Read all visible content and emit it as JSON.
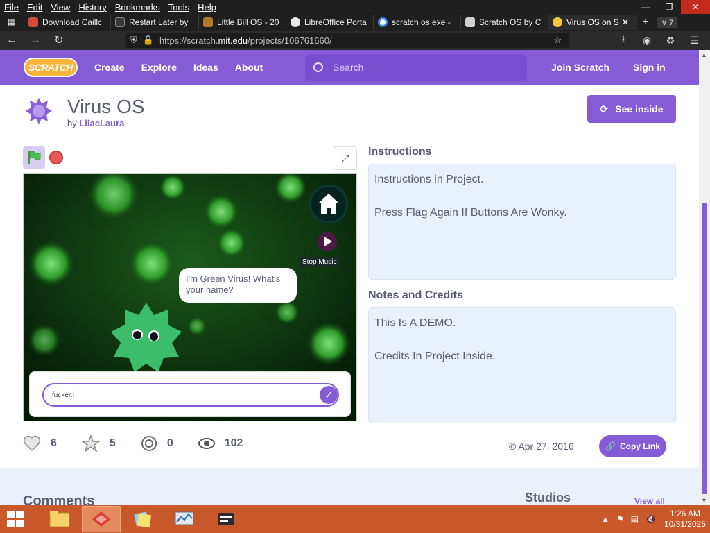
{
  "browser": {
    "menu": [
      "File",
      "Edit",
      "View",
      "History",
      "Bookmarks",
      "Tools",
      "Help"
    ],
    "window_controls": [
      "minimize-icon",
      "restore-icon",
      "close-icon"
    ],
    "tabs": [
      {
        "label": "Download Caillc",
        "favicon_color": "#d14a3c"
      },
      {
        "label": "Restart Later by",
        "favicon_color": "#3a3a3a"
      },
      {
        "label": "Little Bill OS - 20",
        "favicon_color": "#b07a2c"
      },
      {
        "label": "LibreOffice Porta",
        "favicon_color": "#e9e9e9"
      },
      {
        "label": "scratch os exe -",
        "favicon_color": "#ffffff"
      },
      {
        "label": "Scratch OS by C",
        "favicon_color": "#cfcfcf"
      },
      {
        "label": "Virus OS on S",
        "favicon_color": "#f4c542"
      }
    ],
    "tab_count": "7",
    "new_tab": "+",
    "url_prefix": "https://scratch.",
    "url_domain": "mit.edu",
    "url_path": "/projects/106761660/"
  },
  "scratch_nav": {
    "logo": "SCRATCH",
    "links": [
      "Create",
      "Explore",
      "Ideas",
      "About"
    ],
    "search_placeholder": "Search",
    "join": "Join Scratch",
    "signin": "Sign in"
  },
  "project": {
    "title": "Virus OS",
    "by_prefix": "by ",
    "author": "LilacLaura",
    "see_inside": "See inside",
    "stage": {
      "speech": "I'm Green Virus! What's your name?",
      "stop_music": "Stop Music",
      "answer": "fucker.|"
    },
    "instructions_title": "Instructions",
    "instructions": [
      "Instructions in Project.",
      "Press Flag Again If Buttons Are Wonky."
    ],
    "notes_title": "Notes and Credits",
    "notes": [
      "This Is A DEMO.",
      "Credits In Project Inside."
    ],
    "stats": {
      "loves": "6",
      "favorites": "5",
      "remixes": "0",
      "views": "102"
    },
    "date": "Apr 27, 2016",
    "copy_link": "Copy Link",
    "comments_title": "Comments",
    "studios_title": "Studios",
    "view_all": "View all"
  },
  "taskbar": {
    "time": "1:26 AM",
    "date": "10/31/2025"
  },
  "colors": {
    "accent": "#855cd6",
    "taskbar": "#c9582a",
    "stage_bg": "#062d0a"
  }
}
